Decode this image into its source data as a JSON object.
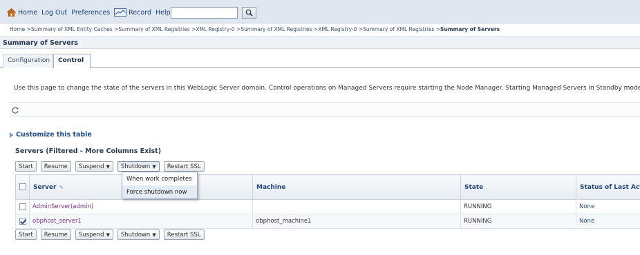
{
  "topbar": {
    "home": "Home",
    "logout": "Log Out",
    "preferences": "Preferences",
    "record": "Record",
    "help": "Help",
    "search_value": ""
  },
  "breadcrumb": {
    "path": "Home >Summary of XML Entity Caches >Summary of XML Registries >XML Registry-0 >Summary of XML Registries >XML Registry-0 >Summary of XML Registries >",
    "current": "Summary of Servers"
  },
  "page": {
    "title": "Summary of Servers",
    "tabs": [
      "Configuration",
      "Control"
    ],
    "active_tab": "Control",
    "description": "Use this page to change the state of the servers in this WebLogic Server domain. Control operations on Managed Servers require starting the Node Manager. Starting Managed Servers in Standby mode requires th"
  },
  "customize": {
    "label": "Customize this table"
  },
  "table": {
    "title": "Servers (Filtered - More Columns Exist)",
    "buttons": {
      "start": "Start",
      "resume": "Resume",
      "suspend": "Suspend",
      "shutdown": "Shutdown",
      "restart_ssl": "Restart SSL"
    },
    "columns": [
      "Server",
      "Machine",
      "State",
      "Status of Last Acti"
    ],
    "rows": [
      {
        "server": "AdminServer(admin)",
        "machine": "",
        "state": "RUNNING",
        "status": "None",
        "checked": false
      },
      {
        "server": "obphost_server1",
        "machine": "obphost_machine1",
        "state": "RUNNING",
        "status": "None",
        "checked": true
      }
    ]
  },
  "shutdown_menu": {
    "items": [
      "When work completes",
      "Force shutdown now"
    ],
    "highlighted": "Force shutdown now"
  },
  "colors": {
    "toolbar_bg": "#dfe7f1",
    "link": "#1f4f8a",
    "visited_link": "#7b2d8e",
    "header_text": "#21467a"
  }
}
